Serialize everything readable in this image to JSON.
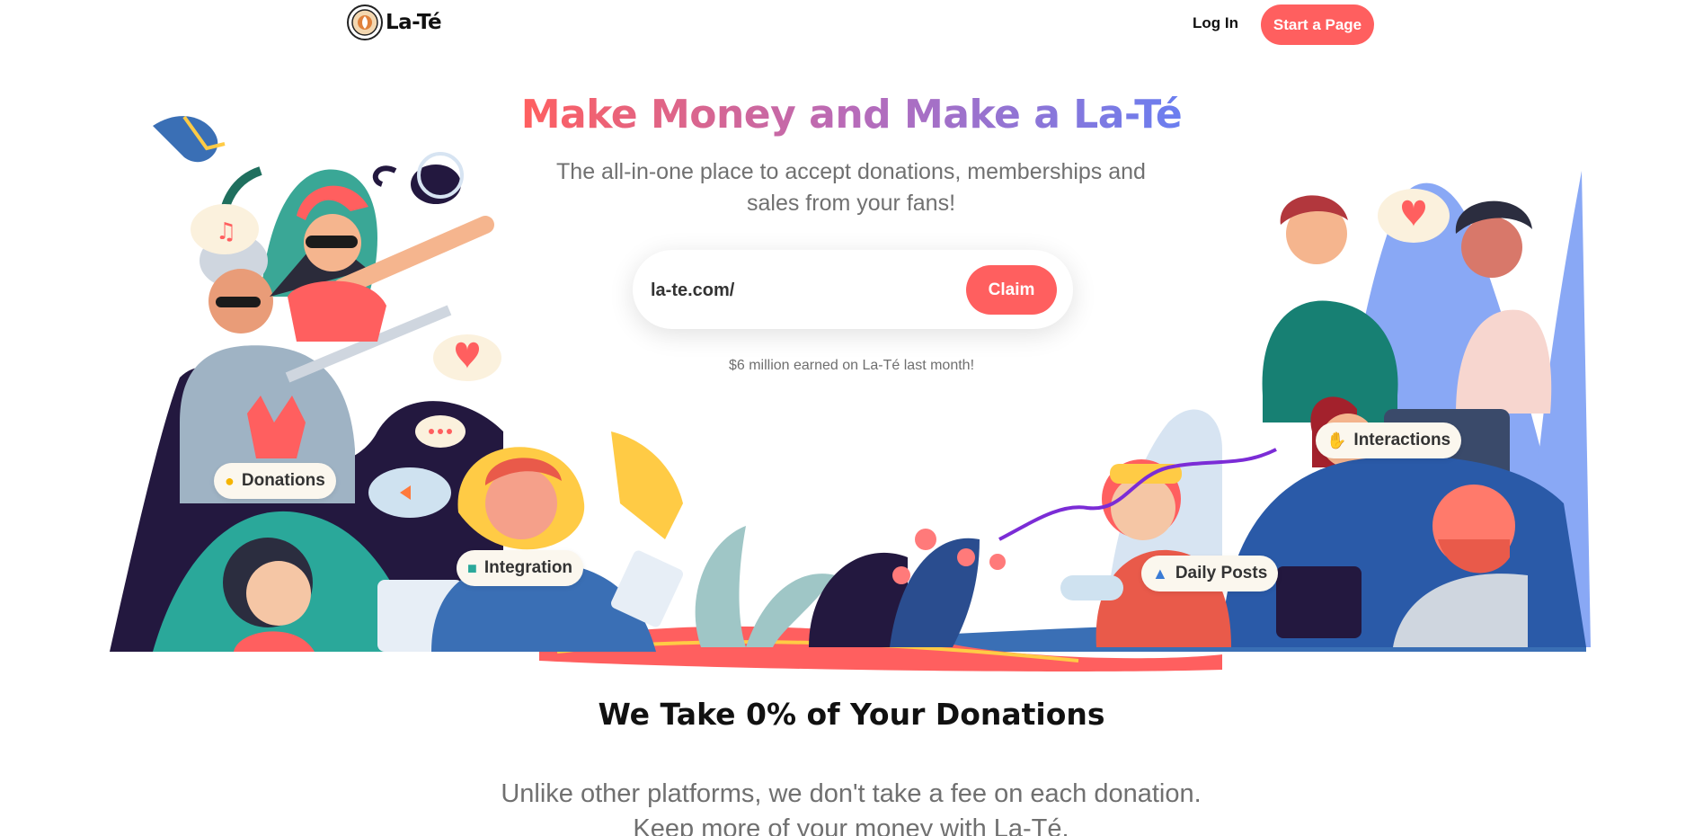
{
  "nav": {
    "brand": "La-Té",
    "login_label": "Log In",
    "start_label": "Start a Page"
  },
  "hero": {
    "title": "Make Money and Make a La-Té",
    "subtitle": "The all-in-one place to accept donations, memberships and sales from your fans!",
    "claim_input_value": "la-te.com/",
    "claim_label": "Claim",
    "earned_note": "$6 million earned on La-Té last month!"
  },
  "tags": {
    "donations": "Donations",
    "integration": "Integration",
    "interactions": "Interactions",
    "daily_posts": "Daily Posts"
  },
  "section": {
    "title": "We Take 0% of Your Donations",
    "text": "Unlike other platforms, we don't take a fee on each donation. Keep more of your money with La-Té."
  },
  "colors": {
    "accent": "#ff5f5f",
    "gradient_start": "#ff5f5f",
    "gradient_end": "#6a7ef0",
    "text_gray": "#707070"
  },
  "icons": {
    "donations": "coin-icon",
    "integration": "puzzle-icon",
    "interactions": "hand-icon",
    "daily_posts": "image-icon"
  }
}
